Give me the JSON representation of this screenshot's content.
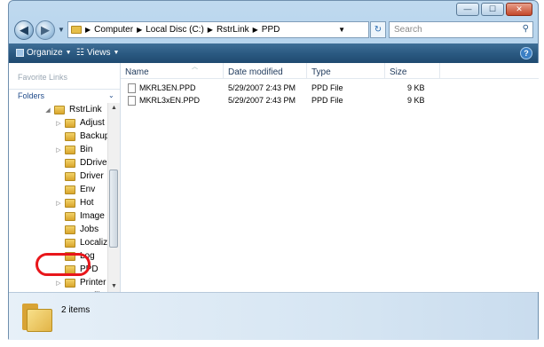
{
  "window": {
    "caption_buttons": {
      "minimize": "—",
      "maximize": "☐",
      "close": "✕"
    }
  },
  "address_bar": {
    "crumbs": [
      "Computer",
      "Local Disc (C:)",
      "RstrLink",
      "PPD"
    ]
  },
  "search": {
    "placeholder": "Search"
  },
  "toolbar": {
    "organize_label": "Organize",
    "views_label": "Views",
    "help_label": "?"
  },
  "nav_pane": {
    "favorite_links": "Favorite Links",
    "folders_label": "Folders",
    "tree": [
      {
        "label": "RstrLink",
        "level": 0,
        "expander": "◢"
      },
      {
        "label": "Adjust",
        "level": 1,
        "expander": "▷"
      },
      {
        "label": "Backup",
        "level": 1,
        "expander": ""
      },
      {
        "label": "Bin",
        "level": 1,
        "expander": "▷"
      },
      {
        "label": "DDriver",
        "level": 1,
        "expander": ""
      },
      {
        "label": "Driver",
        "level": 1,
        "expander": ""
      },
      {
        "label": "Env",
        "level": 1,
        "expander": ""
      },
      {
        "label": "Hot",
        "level": 1,
        "expander": "▷"
      },
      {
        "label": "Image",
        "level": 1,
        "expander": ""
      },
      {
        "label": "Jobs",
        "level": 1,
        "expander": ""
      },
      {
        "label": "Localize",
        "level": 1,
        "expander": ""
      },
      {
        "label": "Log",
        "level": 1,
        "expander": ""
      },
      {
        "label": "PPD",
        "level": 1,
        "expander": ""
      },
      {
        "label": "Printer",
        "level": 1,
        "expander": "▷"
      },
      {
        "label": "Profile",
        "level": 1,
        "expander": "▷"
      }
    ],
    "highlight_color": "#e8161b"
  },
  "file_list": {
    "columns": [
      "Name",
      "Date modified",
      "Type",
      "Size"
    ],
    "rows": [
      {
        "name": "MKRL3EN.PPD",
        "date": "5/29/2007 2:43 PM",
        "type": "PPD File",
        "size": "9 KB"
      },
      {
        "name": "MKRL3xEN.PPD",
        "date": "5/29/2007 2:43 PM",
        "type": "PPD File",
        "size": "9 KB"
      }
    ]
  },
  "details_pane": {
    "item_count": "2 items"
  }
}
